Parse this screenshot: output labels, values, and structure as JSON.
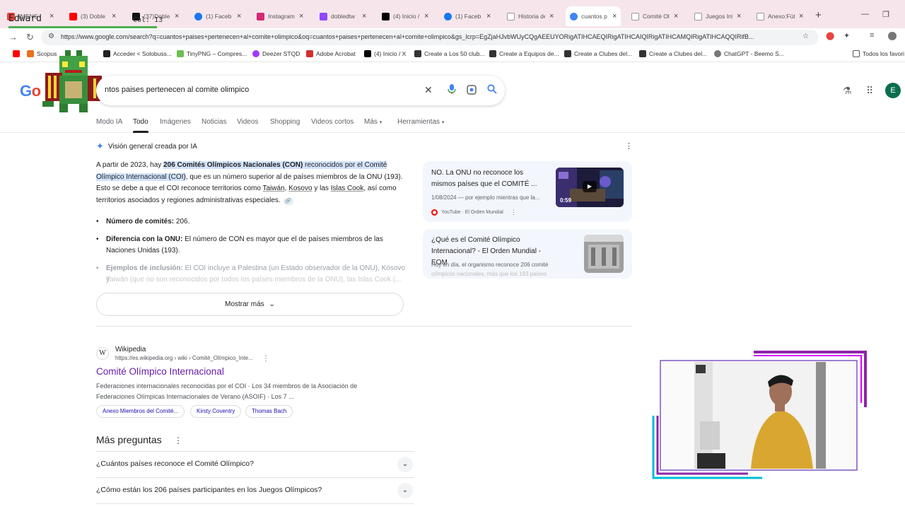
{
  "browser": {
    "tabs": [
      {
        "label": "(MENS",
        "color": "#e8453c"
      },
      {
        "label": "(3) Doble",
        "color": "#ff0000"
      },
      {
        "label": "(37)Doble",
        "color": "#111111"
      },
      {
        "label": "(1) Faceb",
        "color": "#1877f2"
      },
      {
        "label": "Instagram",
        "color": "#d62976"
      },
      {
        "label": "dobledtw",
        "color": "#9146ff"
      },
      {
        "label": "(4) Inicio /",
        "color": "#000000"
      },
      {
        "label": "(1) Faceb",
        "color": "#1877f2"
      },
      {
        "label": "Historia de",
        "color": "#555555"
      },
      {
        "label": "cuantos p",
        "color": "#4285f4"
      },
      {
        "label": "Comité Ol",
        "color": "#555555"
      },
      {
        "label": "Juegos Int",
        "color": "#555555"
      },
      {
        "label": "Anexo:Fút",
        "color": "#555555"
      }
    ],
    "url": "https://www.google.com/search?q=cuantos+paises+pertenecen+al+comite+olimpico&oq=cuantos+paises+pertenecen+al+comite+olimpico&gs_lcrp=EgZjaHJvbWUyCQgAEEUYORigATIHCAEQIRigATIHCAIQIRigATIHCAMQIRigATIHCAQQIRifB...",
    "bookmarks": [
      {
        "label": "",
        "color": "#ff0000"
      },
      {
        "label": "Scopus",
        "color": "#e9711c"
      },
      {
        "label": "Acceder < Solobuss...",
        "color": "#222222"
      },
      {
        "label": "TinyPNG – Compres...",
        "color": "#6cbf4f"
      },
      {
        "label": "Deezer STQD",
        "color": "#a238ff"
      },
      {
        "label": "Adobe Acrobat",
        "color": "#d32f2f"
      },
      {
        "label": "(4) Inicio / X",
        "color": "#000000"
      },
      {
        "label": "Create a Los 50 club...",
        "color": "#333333"
      },
      {
        "label": "Create a Equipos de...",
        "color": "#333333"
      },
      {
        "label": "Create a Clubes del...",
        "color": "#333333"
      },
      {
        "label": "Create a Clubes del...",
        "color": "#333333"
      },
      {
        "label": "ChatGPT - Beemo S...",
        "color": "#777777"
      }
    ],
    "bookmarks_all": "Todos los favori"
  },
  "overlay": {
    "name": "Edward",
    "sub": "Col: 13"
  },
  "search": {
    "query": "ntos paises pertenecen al comite olimpico",
    "avatar_letter": "E"
  },
  "nav": {
    "tabs": [
      "Modo IA",
      "Todo",
      "Imágenes",
      "Noticias",
      "Videos",
      "Shopping",
      "Videos cortos",
      "Más",
      "Herramientas"
    ]
  },
  "ai": {
    "heading": "Visión general creada por IA",
    "p_pre": "A partir de 2023, hay ",
    "p_strong": "206 Comités Olímpicos Nacionales (CON)",
    "p_hl": " reconocidos por el Comité Olímpico Internacional (COI)",
    "p_post1": ", que es un número superior al de países miembros de la ONU (193). Esto se debe a que el COI reconoce territorios como ",
    "p_taiwan": "Taiwán",
    "p_comma": ", ",
    "p_kosovo": "Kosovo",
    "p_y": " y las ",
    "p_islas": "Islas Cook",
    "p_post2": ", así como territorios asociados y regiones administrativas especiales.",
    "b1_label": "Número de comités:",
    "b1_text": " 206.",
    "b2_label": "Diferencia con la ONU:",
    "b2_text": " El número de CON es mayor que el de países miembros de las Naciones Unidas (193).",
    "b3_label": "Ejemplos de inclusión:",
    "b3_text": " El COI incluye a Palestina (un Estado observador de la ONU), Kosovo y",
    "b3_faded": "Taiwán (que no son reconocidos por todos los países miembros de la ONU), las Islas Cook (...",
    "show_more": "Mostrar más"
  },
  "cards": [
    {
      "title": "NO. La ONU no reconoce los mismos países que el COMITÉ ...",
      "meta": "1/08/2024 — por ejemplo mientras que la...",
      "source": "YouTube · El Orden Mundial",
      "duration": "0:59"
    },
    {
      "title": "¿Qué es el Comité Olímpico Internacional? - El Orden Mundial - EOM",
      "meta1": "Hoy en día, el organismo reconoce 206 comités",
      "meta2": "olímpicos nacionales, más que los 193 países en..."
    }
  ],
  "result": {
    "site": "Wikipedia",
    "url": "https://es.wikipedia.org › wiki › Comité_Olímpico_Inte...",
    "title": "Comité Olímpico Internacional",
    "snippet1": "Federaciones internacionales reconocidas por el COI · Los 34 miembros de la Asociación de",
    "snippet2": "Federaciones Olímpicas Internacionales de Verano (ASOIF) · Los 7 ...",
    "chips": [
      "Anexo Miembros del Comité...",
      "Kirsty Coventry",
      "Thomas Bach"
    ]
  },
  "paa": {
    "title": "Más preguntas",
    "questions": [
      "¿Cuántos países reconoce el Comité Olímpico?",
      "¿Cómo están los 206 países participantes en los Juegos Olímpicos?"
    ]
  }
}
